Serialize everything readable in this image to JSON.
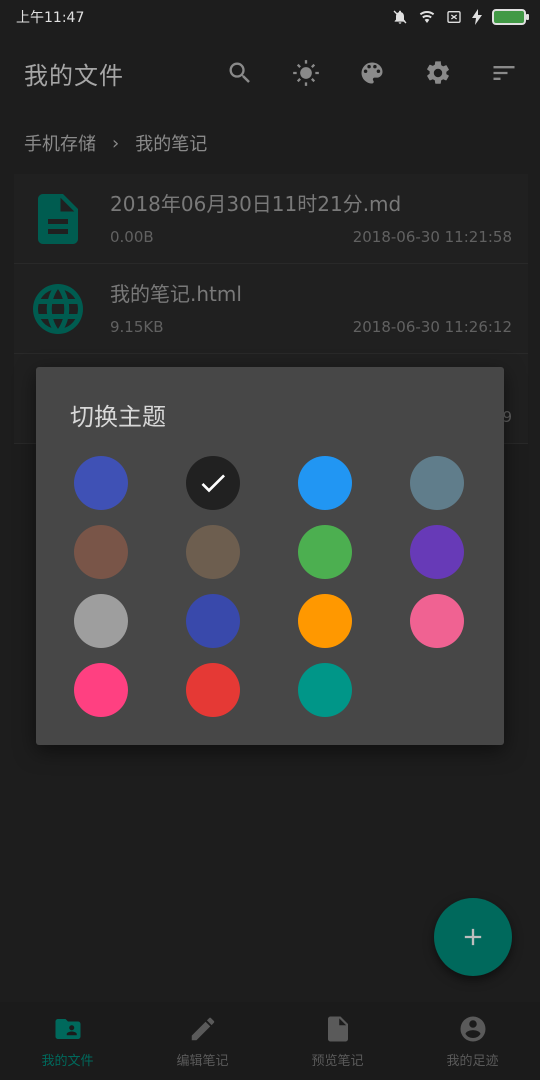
{
  "status_bar": {
    "time": "上午11:47"
  },
  "appbar": {
    "title": "我的文件",
    "actions": [
      "search-icon",
      "brightness-icon",
      "palette-icon",
      "settings-icon",
      "sort-icon"
    ]
  },
  "breadcrumb": {
    "root": "手机存储",
    "separator": "›",
    "current": "我的笔记"
  },
  "files": [
    {
      "name": "2018年06月30日11时21分.md",
      "size": "0.00B",
      "time": "2018-06-30 11:21:58",
      "icon": "document-icon"
    },
    {
      "name": "我的笔记.html",
      "size": "9.15KB",
      "time": "2018-06-30 11:26:12",
      "icon": "globe-icon"
    },
    {
      "name": "",
      "size": "",
      "time": "9",
      "icon": "document-icon"
    }
  ],
  "dialog": {
    "title": "切换主题",
    "colors": [
      "#3F51B5",
      "#212121",
      "#2196F3",
      "#607D8B",
      "#795548",
      "#6D5E4F",
      "#4CAF50",
      "#673AB7",
      "#9E9E9E",
      "#3949AB",
      "#FF9800",
      "#F06292",
      "#FF4081",
      "#E53935",
      "#009688"
    ],
    "selected_index": 1
  },
  "fab": {
    "icon": "plus-icon"
  },
  "bottom_nav": [
    {
      "label": "我的文件",
      "active": true
    },
    {
      "label": "编辑笔记",
      "active": false
    },
    {
      "label": "预览笔记",
      "active": false
    },
    {
      "label": "我的足迹",
      "active": false
    }
  ]
}
